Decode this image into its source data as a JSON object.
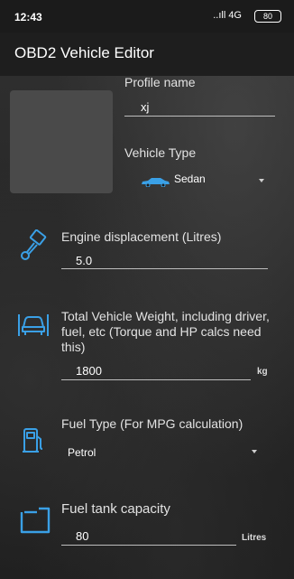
{
  "status_bar": {
    "time": "12:43",
    "signal": "..ıll 4G",
    "battery": "80"
  },
  "app_bar": {
    "title": "OBD2 Vehicle Editor"
  },
  "profile": {
    "name_label": "Profile name",
    "name_value": "xj",
    "vehicle_type_label": "Vehicle Type",
    "vehicle_type_value": "Sedan",
    "vehicle_type_icon": "car-icon"
  },
  "engine": {
    "label": "Engine displacement (Litres)",
    "value": "5.0",
    "icon": "piston-icon"
  },
  "weight": {
    "label": "Total Vehicle Weight, including driver, fuel, etc (Torque and HP calcs need this)",
    "value": "1800",
    "unit": "kg",
    "icon": "car-lift-icon"
  },
  "fuel_type": {
    "label": "Fuel Type (For MPG calculation)",
    "value": "Petrol",
    "icon": "fuel-pump-icon"
  },
  "fuel_tank": {
    "label": "Fuel tank capacity",
    "value": "80",
    "unit": "Litres",
    "icon": "fuel-tank-icon"
  },
  "colors": {
    "accent_icon": "#3aa0e6",
    "background": "#262626"
  }
}
